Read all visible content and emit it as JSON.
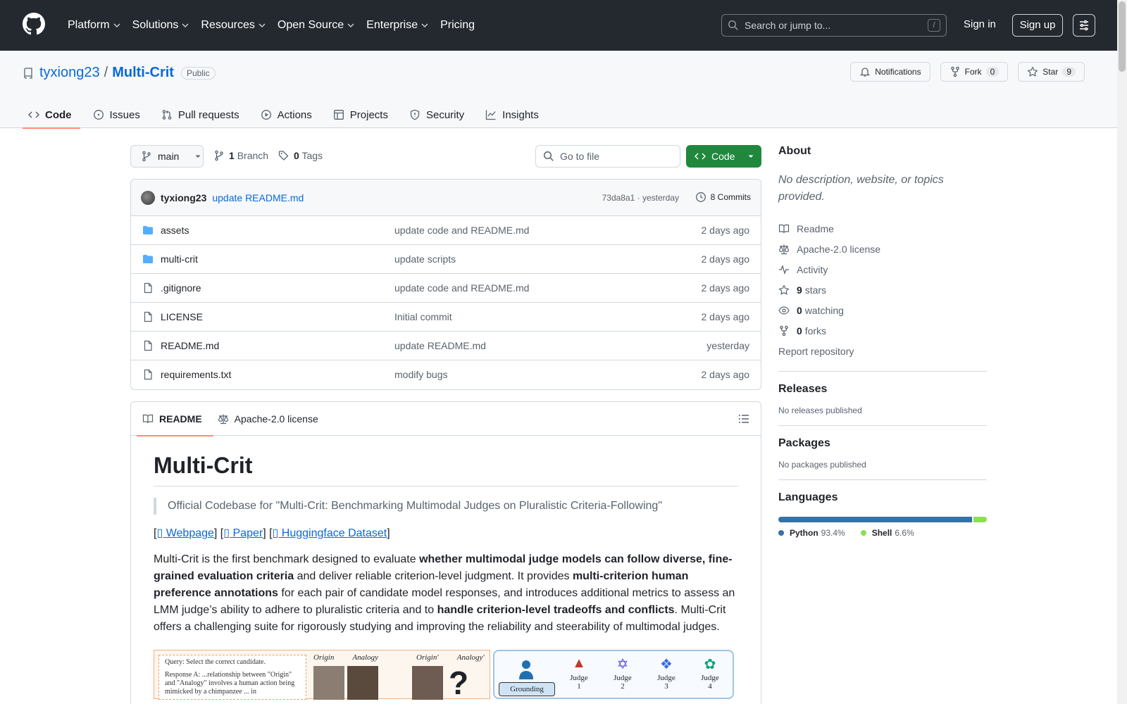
{
  "header": {
    "nav": [
      "Platform",
      "Solutions",
      "Resources",
      "Open Source",
      "Enterprise",
      "Pricing"
    ],
    "search_placeholder": "Search or jump to...",
    "search_shortcut": "/",
    "signin": "Sign in",
    "signup": "Sign up"
  },
  "repo": {
    "owner": "tyxiong23",
    "name": "Multi-Crit",
    "visibility": "Public",
    "notifications": "Notifications",
    "fork_label": "Fork",
    "fork_count": "0",
    "star_label": "Star",
    "star_count": "9"
  },
  "tabs": [
    "Code",
    "Issues",
    "Pull requests",
    "Actions",
    "Projects",
    "Security",
    "Insights"
  ],
  "branch": {
    "name": "main",
    "branches_count": "1",
    "branches_label": "Branch",
    "tags_count": "0",
    "tags_label": "Tags",
    "goto_placeholder": "Go to file",
    "code_button": "Code"
  },
  "latest_commit": {
    "author": "tyxiong23",
    "message": "update README.md",
    "hash_time": "73da8a1 · yesterday",
    "commits": "8 Commits"
  },
  "files": [
    {
      "type": "folder",
      "name": "assets",
      "message": "update code and README.md",
      "date": "2 days ago"
    },
    {
      "type": "folder",
      "name": "multi-crit",
      "message": "update scripts",
      "date": "2 days ago"
    },
    {
      "type": "file",
      "name": ".gitignore",
      "message": "update code and README.md",
      "date": "2 days ago"
    },
    {
      "type": "file",
      "name": "LICENSE",
      "message": "Initial commit",
      "date": "2 days ago"
    },
    {
      "type": "file",
      "name": "README.md",
      "message": "update README.md",
      "date": "yesterday"
    },
    {
      "type": "file",
      "name": "requirements.txt",
      "message": "modify bugs",
      "date": "2 days ago"
    }
  ],
  "readme": {
    "tab_readme": "README",
    "tab_license": "Apache-2.0 license",
    "title": "Multi-Crit",
    "quote": "Official Codebase for \"Multi-Crit: Benchmarking Multimodal Judges on Pluralistic Criteria-Following\"",
    "link_webpage": "Webpage",
    "link_paper": "Paper",
    "link_dataset": "Huggingface Dataset",
    "p1": "Multi-Crit is the first benchmark designed to evaluate ",
    "p1b": "whether multimodal judge models can follow diverse, fine-grained evaluation criteria",
    "p2": " and deliver reliable criterion-level judgment. It provides ",
    "p2b": "multi-criterion human preference annotations",
    "p3": " for each pair of candidate model responses, and introduces additional metrics to assess an LMM judge’s ability to adhere to pluralistic criteria and to ",
    "p3b": "handle criterion-level tradeoffs and conflicts",
    "p4": ". Multi-Crit offers a challenging suite for rigorously studying and improving the reliability and steerability of multimodal judges.",
    "fig_query": "Query: Select the correct candidate.",
    "fig_response": "Response A: ...relationship between \"Origin\" and \"Analogy\" involves a human action being mimicked by a chimpanzee ... in",
    "fig_labels": [
      "Origin",
      "Analogy",
      "Origin'",
      "Analogy'"
    ],
    "fig_grounding": "Grounding",
    "fig_judges": [
      "Judge 1",
      "Judge 2",
      "Judge 3",
      "Judge 4"
    ]
  },
  "sidebar": {
    "about": "About",
    "description": "No description, website, or topics provided.",
    "items": [
      {
        "icon": "book-icon",
        "text": "Readme"
      },
      {
        "icon": "scale-icon",
        "text": "Apache-2.0 license"
      },
      {
        "icon": "pulse-icon",
        "text": "Activity"
      }
    ],
    "stars_count": "9",
    "stars_label": "stars",
    "watching_count": "0",
    "watching_label": "watching",
    "forks_count": "0",
    "forks_label": "forks",
    "report": "Report repository",
    "releases": "Releases",
    "releases_none": "No releases published",
    "packages": "Packages",
    "packages_none": "No packages published",
    "languages": "Languages",
    "langs": [
      {
        "name": "Python",
        "percent": "93.4%",
        "color": "#3572A5"
      },
      {
        "name": "Shell",
        "percent": "6.6%",
        "color": "#89e051"
      }
    ]
  }
}
